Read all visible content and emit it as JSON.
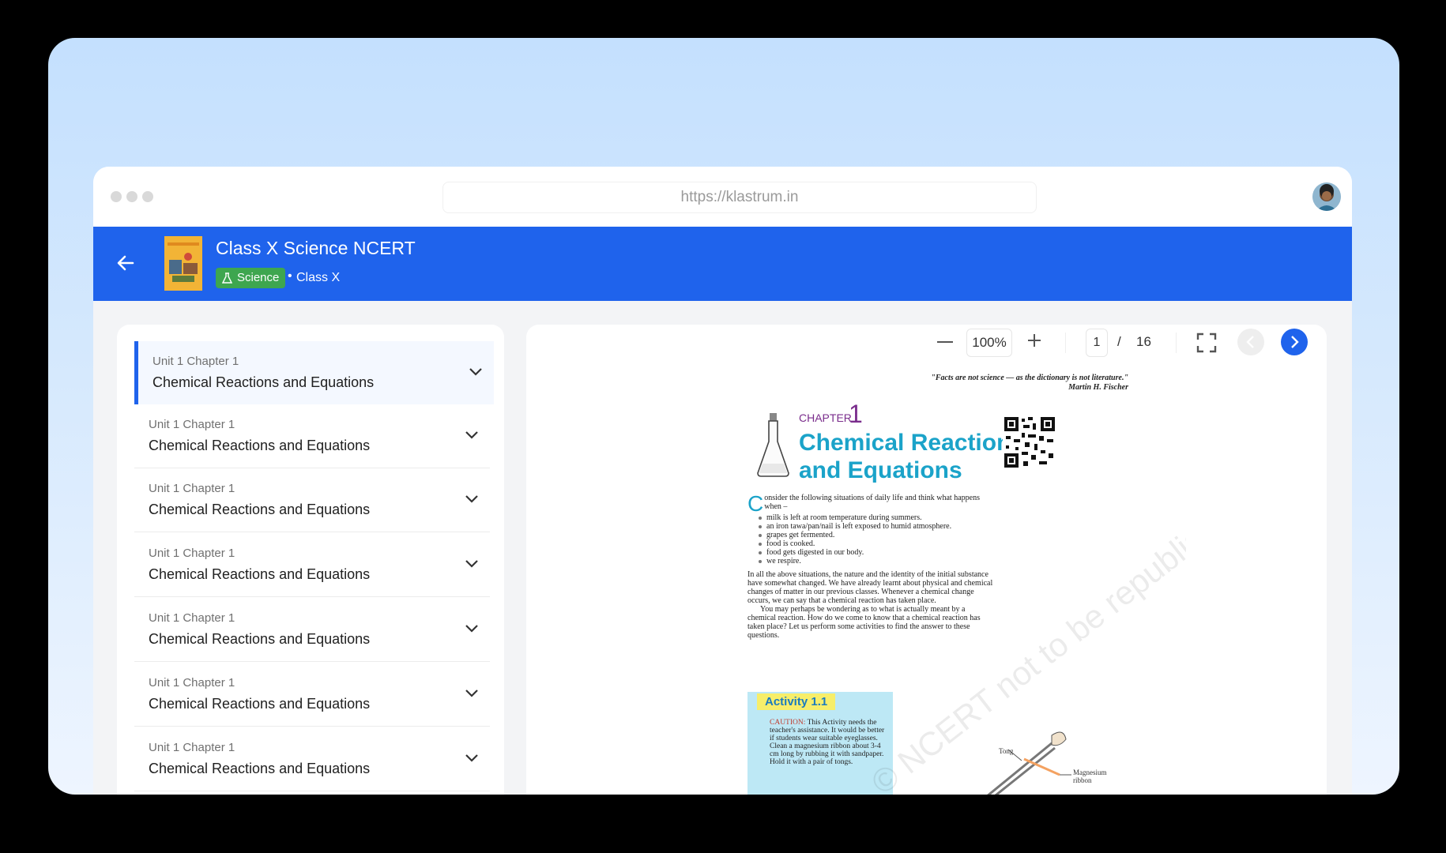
{
  "browser": {
    "url": "https://klastrum.in"
  },
  "header": {
    "title": "Class X Science NCERT",
    "subject_tag": "Science",
    "separator": "•",
    "class_label": "Class X"
  },
  "chapters": [
    {
      "unit": "Unit 1 Chapter 1",
      "title": "Chemical Reactions and Equations",
      "active": true
    },
    {
      "unit": "Unit 1 Chapter 1",
      "title": "Chemical Reactions and Equations",
      "active": false
    },
    {
      "unit": "Unit 1 Chapter 1",
      "title": "Chemical Reactions and Equations",
      "active": false
    },
    {
      "unit": "Unit 1 Chapter 1",
      "title": "Chemical Reactions and Equations",
      "active": false
    },
    {
      "unit": "Unit 1 Chapter 1",
      "title": "Chemical Reactions and Equations",
      "active": false
    },
    {
      "unit": "Unit 1 Chapter 1",
      "title": "Chemical Reactions and Equations",
      "active": false
    },
    {
      "unit": "Unit 1 Chapter 1",
      "title": "Chemical Reactions and Equations",
      "active": false
    }
  ],
  "viewer": {
    "zoom": "100%",
    "current_page": "1",
    "page_separator": "/",
    "total_pages": "16"
  },
  "document": {
    "quote_line1": "\"Facts are not science — as the dictionary is not literature.\"",
    "quote_line2": "Martin H. Fischer",
    "chapter_label": "CHAPTER",
    "chapter_number": "1",
    "chapter_title_line1": "Chemical Reactions",
    "chapter_title_line2": "and Equations",
    "dropcap": "C",
    "intro": "onsider the following situations of daily life and think what happens when –",
    "bullets": [
      "milk is left at room temperature during summers.",
      "an iron tawa/pan/nail is left exposed to humid atmosphere.",
      "grapes get fermented.",
      "food is cooked.",
      "food gets digested in our body.",
      "we respire."
    ],
    "paragraph1": "In all the above situations, the nature and the identity of the initial substance have somewhat changed. We have already learnt about physical and chemical changes of matter in our previous classes. Whenever a chemical change occurs, we can say that a chemical reaction has taken place.",
    "paragraph2": "You may perhaps be wondering as to what is actually meant by a chemical reaction. How do we come to know that a chemical reaction has taken place? Let us perform some activities to find the answer to these questions.",
    "activity_title": "Activity 1.1",
    "caution_label": "CAUTION:",
    "caution_text": " This Activity needs the teacher's assistance. It would be better if students wear suitable eyeglasses.",
    "activity_step1": "Clean a magnesium ribbon about 3-4 cm long by rubbing it with sandpaper.",
    "activity_step2": "Hold it with a pair of tongs.",
    "figure_label_tong": "Tong",
    "figure_label_ribbon": "Magnesium ribbon",
    "watermark": "© NCERT not to be republished"
  },
  "colors": {
    "brand_blue": "#1f63ec",
    "subject_green": "#3ea64f",
    "chapter_purple": "#7a2d8c",
    "title_cyan": "#1ba3c9"
  }
}
